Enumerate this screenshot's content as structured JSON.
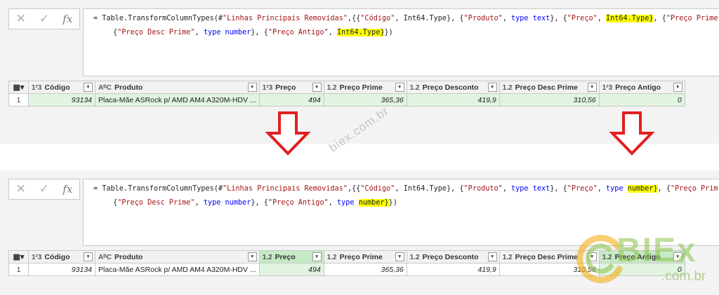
{
  "toolbar": {
    "cancel_glyph": "✕",
    "enter_glyph": "✓",
    "fx_label": "fx"
  },
  "top": {
    "formula": {
      "line1_a": "= Table.TransformColumnTypes(#",
      "line1_src": "\"Linhas Principais Removidas\"",
      "line1_b": ",{{",
      "c1": "\"Código\"",
      "t1": "Int64.Type",
      "c2": "\"Produto\"",
      "t2": "type text",
      "c3": "\"Preço\"",
      "t3_hl": "Int64.Type}",
      "c4": "\"Preço Prime\"",
      "c5": "\"Preço Desc Prime\"",
      "t5": "type number",
      "c6": "\"Preço Antigo\"",
      "t6_hl": "Int64.Type}",
      "line2_end": "})"
    },
    "columns": [
      {
        "type": "1²3",
        "name": "Código"
      },
      {
        "type": "AᴮC",
        "name": "Produto"
      },
      {
        "type": "1²3",
        "name": "Preço"
      },
      {
        "type": "1.2",
        "name": "Preço Prime"
      },
      {
        "type": "1.2",
        "name": "Preço Desconto"
      },
      {
        "type": "1.2",
        "name": "Preço Desc Prime"
      },
      {
        "type": "1²3",
        "name": "Preço Antigo"
      }
    ],
    "row": {
      "n": "1",
      "codigo": "93134",
      "produto": "Placa-Mãe ASRock p/ AMD AM4 A320M-HDV ...",
      "preco": "494",
      "prime": "365,36",
      "desconto": "419,9",
      "descprime": "310,56",
      "antigo": "0"
    }
  },
  "bottom": {
    "formula": {
      "line1_a": "= Table.TransformColumnTypes(#",
      "line1_src": "\"Linhas Principais Removidas\"",
      "line1_b": ",{{",
      "c1": "\"Código\"",
      "t1": "Int64.Type",
      "c2": "\"Produto\"",
      "t2": "type text",
      "c3": "\"Preço\"",
      "t3_kw": "type",
      "t3_hl": "number}",
      "c4": "\"Preço Prim",
      "c5": "\"Preço Desc Prime\"",
      "t5": "type number",
      "c6": "\"Preço Antigo\"",
      "t6_kw": "type",
      "t6_hl": "number}",
      "line2_end": "})"
    },
    "columns": [
      {
        "type": "1²3",
        "name": "Código"
      },
      {
        "type": "AᴮC",
        "name": "Produto"
      },
      {
        "type": "1.2",
        "name": "Preço"
      },
      {
        "type": "1.2",
        "name": "Preço Prime"
      },
      {
        "type": "1.2",
        "name": "Preço Desconto"
      },
      {
        "type": "1.2",
        "name": "Preço Desc Prime"
      },
      {
        "type": "1.2",
        "name": "Preço Antigo"
      }
    ],
    "row": {
      "n": "1",
      "codigo": "93134",
      "produto": "Placa-Mãe ASRock p/ AMD AM4 A320M-HDV ...",
      "preco": "494",
      "prime": "365,36",
      "desconto": "419,9",
      "descprime": "310,56",
      "antigo": "0"
    }
  },
  "watermark": "biex.com.br",
  "logo": {
    "name": "BIEx",
    "sub": ".com.br"
  },
  "colors": {
    "highlight": "#ffff00",
    "arrow": "#e02020",
    "selected_col": "#c6e9c6",
    "cell_bg": "#e1f3e1"
  }
}
